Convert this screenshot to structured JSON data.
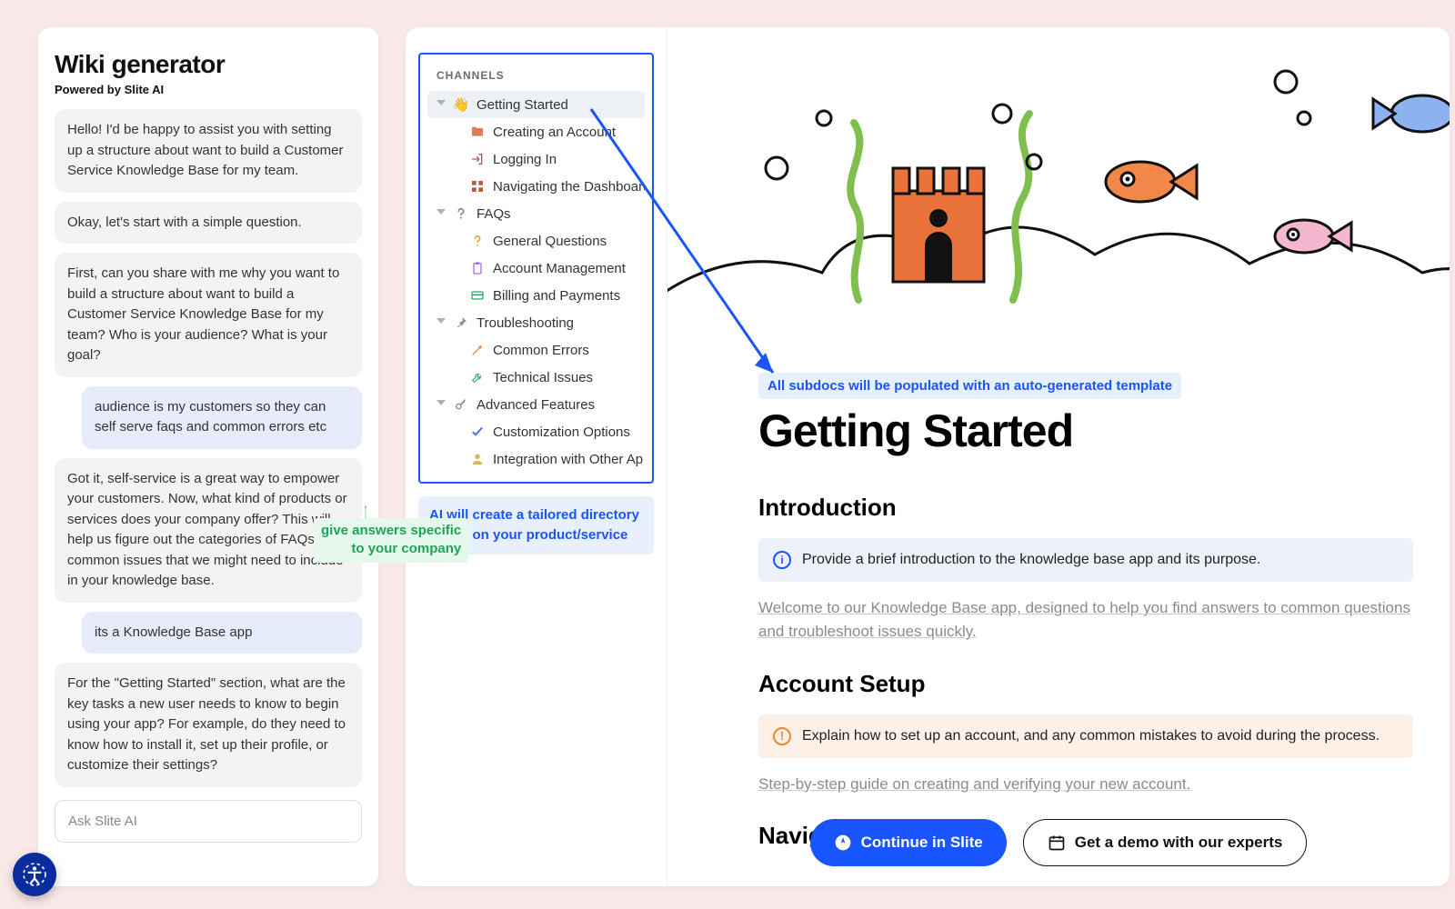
{
  "chat": {
    "title": "Wiki generator",
    "subtitle": "Powered by Slite AI",
    "messages": [
      {
        "role": "bot",
        "text": "Hello! I'd be happy to assist you with setting up a structure about want to build a Customer Service Knowledge Base for my team."
      },
      {
        "role": "bot",
        "text": "Okay, let's start with a simple question."
      },
      {
        "role": "bot",
        "text": "First, can you share with me why you want to build a structure about want to build a Customer Service Knowledge Base for my team? Who is your audience? What is your goal?"
      },
      {
        "role": "user",
        "text": "audience is my customers so they can self serve faqs and common errors etc"
      },
      {
        "role": "bot",
        "text": "Got it, self-service is a great way to empower your customers. Now, what kind of products or services does your company offer? This will help us figure out the categories of FAQs and common issues that we might need to include in your knowledge base."
      },
      {
        "role": "user",
        "text": "its a Knowledge Base app"
      },
      {
        "role": "bot",
        "text": "For the \"Getting Started\" section, what are the key tasks a new user needs to know to begin using your app? For example, do they need to know how to install it, set up their profile, or customize their settings?"
      }
    ],
    "input_placeholder": "Ask Slite AI"
  },
  "annotations": {
    "green": "give answers specific\nto your company",
    "sidebar_caption": "AI will create a tailored directory based on your product/service",
    "doc_hint": "All subdocs will be populated with an auto-generated template"
  },
  "sidebar": {
    "heading": "CHANNELS",
    "tree": [
      {
        "label": "Getting Started",
        "icon": "👋",
        "selected": true,
        "children": [
          {
            "label": "Creating an Account",
            "icon": "folder",
            "color": "#e67a4e"
          },
          {
            "label": "Logging In",
            "icon": "login",
            "color": "#b44a9c"
          },
          {
            "label": "Navigating the Dashboard",
            "icon": "grid",
            "color": "#c0563e"
          }
        ]
      },
      {
        "label": "FAQs",
        "icon": "question",
        "children": [
          {
            "label": "General Questions",
            "icon": "question",
            "color": "#e6a63c"
          },
          {
            "label": "Account Management",
            "icon": "clipboard",
            "color": "#9c73e6"
          },
          {
            "label": "Billing and Payments",
            "icon": "card",
            "color": "#2fa56a"
          }
        ]
      },
      {
        "label": "Troubleshooting",
        "icon": "pin",
        "children": [
          {
            "label": "Common Errors",
            "icon": "wand",
            "color": "#e6863c"
          },
          {
            "label": "Technical Issues",
            "icon": "wrench",
            "color": "#4fa8a0"
          }
        ]
      },
      {
        "label": "Advanced Features",
        "icon": "key",
        "children": [
          {
            "label": "Customization Options",
            "icon": "check",
            "color": "#4a72e6"
          },
          {
            "label": "Integration with Other Ap…",
            "icon": "person",
            "color": "#d6b85a"
          }
        ]
      }
    ]
  },
  "document": {
    "title": "Getting Started",
    "sections": [
      {
        "heading": "Introduction",
        "callout_type": "info",
        "callout": "Provide a brief introduction to the knowledge base app and its purpose.",
        "body": "Welcome to our Knowledge Base app, designed to help you find answers to common questions and troubleshoot issues quickly."
      },
      {
        "heading": "Account Setup",
        "callout_type": "warn",
        "callout": "Explain how to set up an account, and any common mistakes to avoid during the process.",
        "body": "Step-by-step guide on creating and verifying your new account."
      },
      {
        "heading": "Navigating the App",
        "callout_type": "none",
        "callout": "",
        "body": ""
      }
    ]
  },
  "cta": {
    "primary": "Continue in Slite",
    "secondary": "Get a demo with our experts"
  }
}
